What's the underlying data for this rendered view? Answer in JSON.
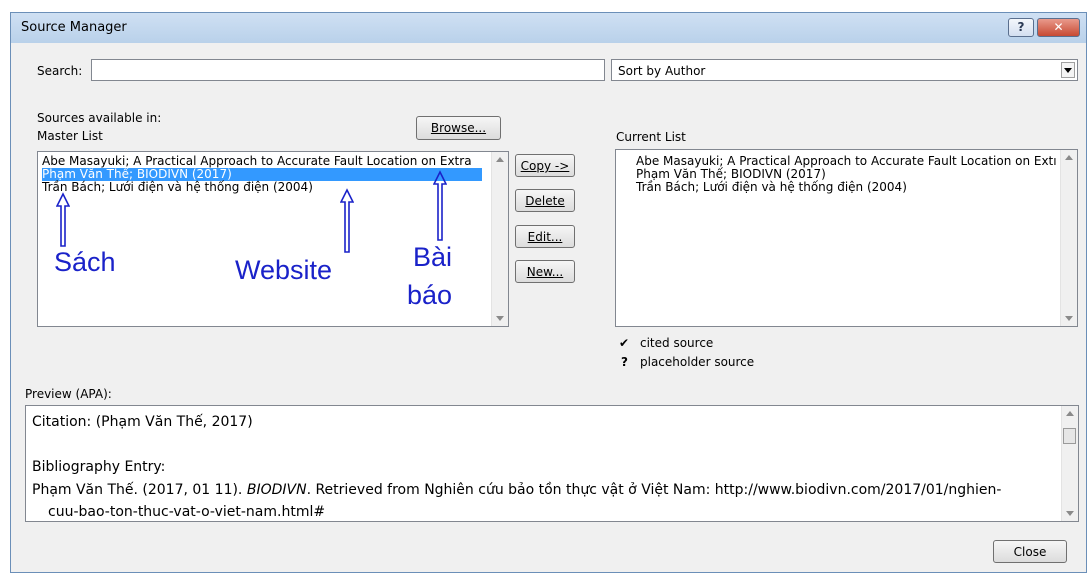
{
  "window": {
    "title": "Source Manager",
    "help_label": "?",
    "close_label": "✕"
  },
  "search": {
    "label": "Search:",
    "value": ""
  },
  "sort": {
    "value": "Sort by Author"
  },
  "master": {
    "sources_label": "Sources available in:",
    "list_label": "Master List",
    "browse_label": "Browse...",
    "items": [
      "Abe Masayuki; A Practical Approach to Accurate Fault Location on Extra",
      "Phạm Văn Thế; BIODIVN (2017)",
      "Trần Bách; Lưới điện và hệ thống điện (2004)"
    ],
    "selected_index": 1
  },
  "actions": {
    "copy": "Copy ->",
    "delete": "Delete",
    "edit": "Edit...",
    "new": "New..."
  },
  "current": {
    "list_label": "Current List",
    "items": [
      "Abe Masayuki; A Practical Approach to Accurate Fault Location on Extı",
      "Phạm Văn Thế; BIODIVN (2017)",
      "Trần Bách; Lưới điện và hệ thống điện (2004)"
    ]
  },
  "legend": {
    "cited_mark": "✔",
    "cited_label": "cited source",
    "placeholder_mark": "?",
    "placeholder_label": "placeholder source"
  },
  "annotations": {
    "sach": "Sách",
    "website": "Website",
    "bai": "Bài",
    "bao": "báo",
    "color": "#1a22c9"
  },
  "preview": {
    "label": "Preview (APA):",
    "citation": "Citation:  (Phạm Văn Thế, 2017)",
    "bibliography_heading": "Bibliography Entry:",
    "entry_author": "Phạm Văn Thế. (2017, 01 11). ",
    "entry_title": "BIODIVN",
    "entry_rest": ". Retrieved from Nghiên cứu bảo tồn thực vật ở Việt Nam: http://www.biodivn.com/2017/01/nghien-",
    "entry_cont": "cuu-bao-ton-thuc-vat-o-viet-nam.html#"
  },
  "close_button": "Close",
  "colors": {
    "selection": "#3399ff",
    "annotation": "#1a22c9"
  }
}
